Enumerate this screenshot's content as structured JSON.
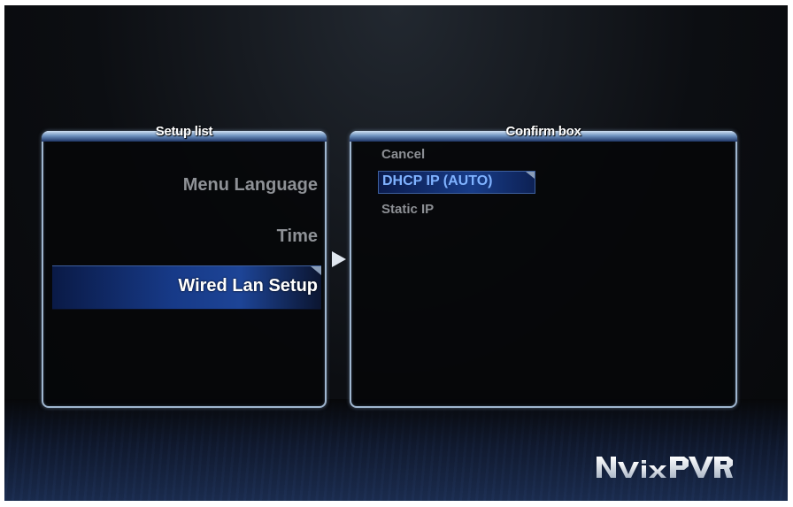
{
  "setup_list": {
    "title": "Setup list",
    "items": [
      {
        "label": "Menu Language",
        "selected": false
      },
      {
        "label": "Time",
        "selected": false
      },
      {
        "label": "Wired Lan Setup",
        "selected": true
      }
    ]
  },
  "confirm_box": {
    "title": "Confirm box",
    "options": [
      {
        "label": "Cancel",
        "selected": false
      },
      {
        "label": "DHCP IP (AUTO)",
        "selected": true
      },
      {
        "label": "Static IP",
        "selected": false
      }
    ]
  },
  "logo": {
    "text": "NVIXPVR"
  },
  "icons": {
    "navigation_arrow": "right-arrow-icon"
  },
  "colors": {
    "selection_blue": "#173a88",
    "panel_border": "#9fb6cf",
    "selected_text": "#ffffff",
    "highlight_option_text": "#7fb2ff",
    "inactive_text": "#8e9196"
  }
}
